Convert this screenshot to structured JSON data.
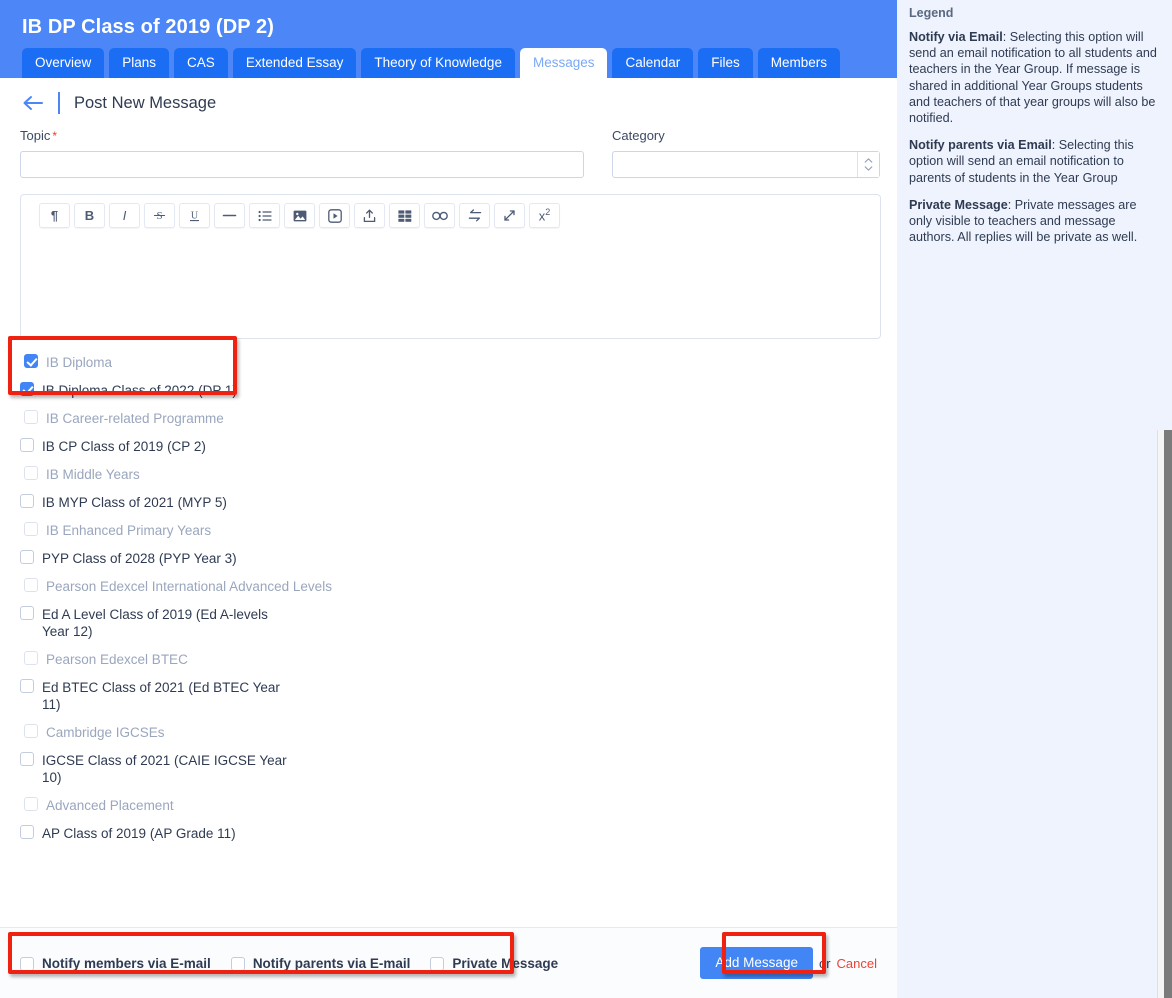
{
  "header": {
    "title": "IB DP Class of 2019 (DP 2)",
    "tabs": [
      {
        "label": "Overview",
        "active": false
      },
      {
        "label": "Plans",
        "active": false
      },
      {
        "label": "CAS",
        "active": false
      },
      {
        "label": "Extended Essay",
        "active": false
      },
      {
        "label": "Theory of Knowledge",
        "active": false
      },
      {
        "label": "Messages",
        "active": true
      },
      {
        "label": "Calendar",
        "active": false
      },
      {
        "label": "Files",
        "active": false
      },
      {
        "label": "Members",
        "active": false
      }
    ]
  },
  "breadcrumb": {
    "back_icon": "arrow-left-icon",
    "title": "Post New Message"
  },
  "form": {
    "topic": {
      "label": "Topic",
      "required_marker": "*",
      "value": "",
      "placeholder": ""
    },
    "category": {
      "label": "Category",
      "value": "",
      "placeholder": ""
    }
  },
  "editor": {
    "toolbar": [
      {
        "name": "paragraph-icon",
        "glyph": "¶"
      },
      {
        "name": "bold-icon",
        "glyph": "B"
      },
      {
        "name": "italic-icon",
        "glyph": "I"
      },
      {
        "name": "strikethrough-icon",
        "glyph": "S"
      },
      {
        "name": "underline-icon",
        "glyph": "U"
      },
      {
        "name": "horizontal-rule-icon",
        "glyph": "—"
      },
      {
        "name": "bullet-list-icon",
        "glyph": "☰"
      },
      {
        "name": "image-icon",
        "glyph": "⬛"
      },
      {
        "name": "video-icon",
        "glyph": "▶"
      },
      {
        "name": "upload-icon",
        "glyph": "↥"
      },
      {
        "name": "table-icon",
        "glyph": "▦"
      },
      {
        "name": "link-icon",
        "glyph": "∞"
      },
      {
        "name": "swap-icon",
        "glyph": "⇆"
      },
      {
        "name": "expand-icon",
        "glyph": "↗"
      },
      {
        "name": "superscript-icon",
        "glyph": "x²"
      }
    ],
    "content": ""
  },
  "groups": [
    {
      "header": {
        "label": "IB Diploma",
        "checked": true
      },
      "items": [
        {
          "label": "IB Diploma Class of 2022 (DP 1)",
          "checked": true
        }
      ]
    },
    {
      "header": {
        "label": "IB Career-related Programme",
        "checked": false
      },
      "items": [
        {
          "label": "IB CP Class of 2019 (CP 2)",
          "checked": false
        }
      ]
    },
    {
      "header": {
        "label": "IB Middle Years",
        "checked": false
      },
      "items": [
        {
          "label": "IB MYP Class of 2021 (MYP 5)",
          "checked": false
        }
      ]
    },
    {
      "header": {
        "label": "IB Enhanced Primary Years",
        "checked": false
      },
      "items": [
        {
          "label": "PYP Class of 2028 (PYP Year 3)",
          "checked": false
        }
      ]
    },
    {
      "header": {
        "label": "Pearson Edexcel International Advanced Levels",
        "checked": false
      },
      "items": [
        {
          "label": "Ed A Level Class of 2019 (Ed A-levels Year 12)",
          "checked": false
        }
      ]
    },
    {
      "header": {
        "label": "Pearson Edexcel BTEC",
        "checked": false
      },
      "items": [
        {
          "label": "Ed BTEC Class of 2021 (Ed BTEC Year 11)",
          "checked": false
        }
      ]
    },
    {
      "header": {
        "label": "Cambridge IGCSEs",
        "checked": false
      },
      "items": [
        {
          "label": "IGCSE Class of 2021 (CAIE IGCSE Year 10)",
          "checked": false
        }
      ]
    },
    {
      "header": {
        "label": "Advanced Placement",
        "checked": false
      },
      "items": [
        {
          "label": "AP Class of 2019 (AP Grade 11)",
          "checked": false
        }
      ]
    }
  ],
  "footer": {
    "notify_options": [
      {
        "label": "Notify members via E-mail",
        "checked": false
      },
      {
        "label": "Notify parents via E-mail",
        "checked": false
      },
      {
        "label": "Private Message",
        "checked": false
      }
    ],
    "submit_label": "Add Message",
    "or_label": "or",
    "cancel_label": "Cancel"
  },
  "legend": {
    "title": "Legend",
    "entries": [
      {
        "term": "Notify via Email",
        "text": ": Selecting this option will send an email notification to all students and teachers in the Year Group. If message is shared in additional Year Groups students and teachers of that year groups will also be notified."
      },
      {
        "term": "Notify parents via Email",
        "text": ": Selecting this option will send an email notification to parents of students in the Year Group"
      },
      {
        "term": "Private Message",
        "text": ": Private messages are only visible to teachers and message authors. All replies will be private as well."
      }
    ]
  },
  "colors": {
    "header_blue": "#4d86f7",
    "tab_blue": "#1b6ef3",
    "accent_blue": "#4285f4",
    "highlight_red": "#ef2111",
    "cancel_red": "#ef4136",
    "legend_bg": "#eef3fd"
  }
}
